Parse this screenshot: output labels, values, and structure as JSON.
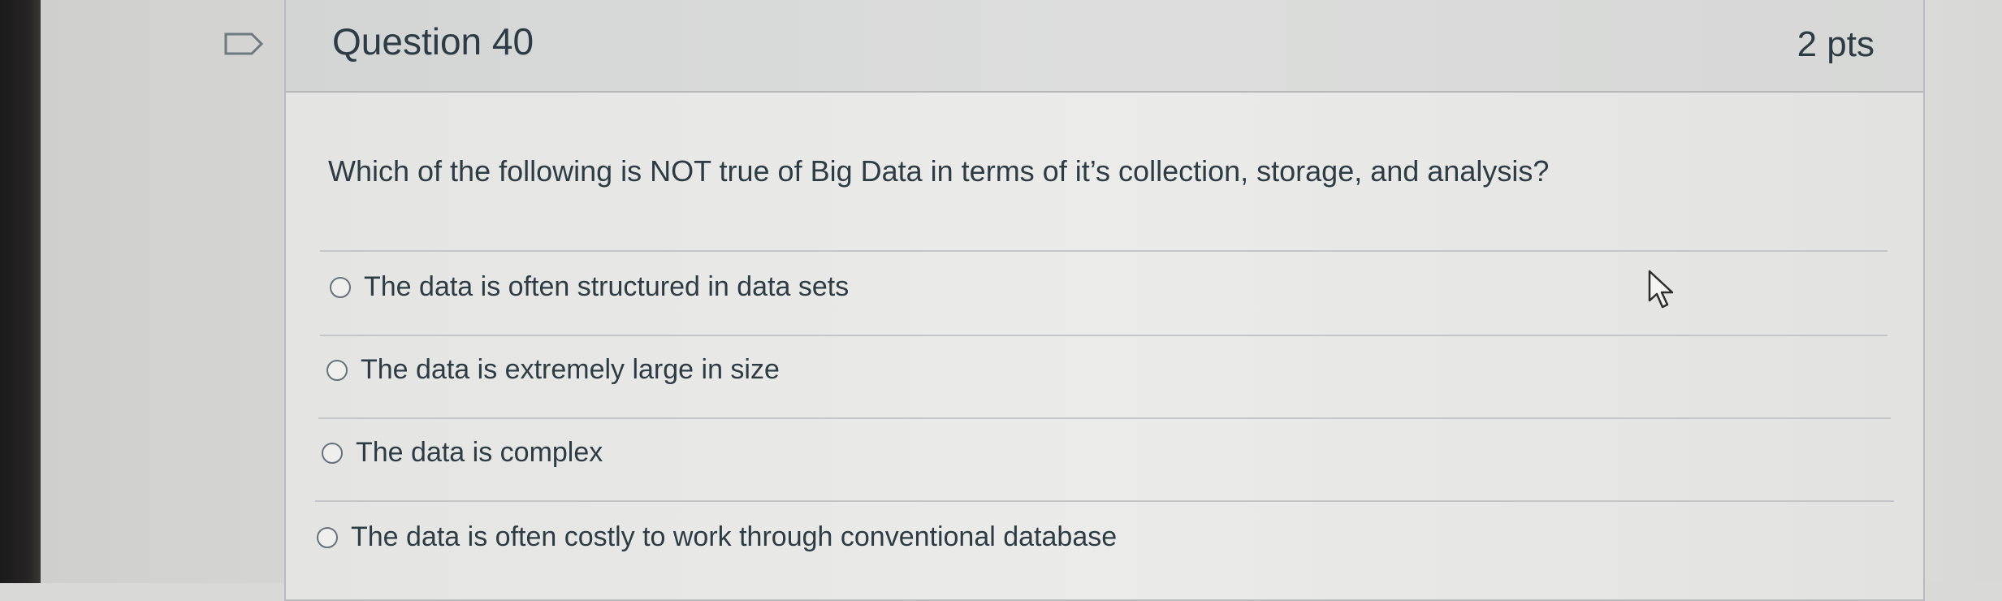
{
  "question": {
    "title": "Question 40",
    "points": "2 pts",
    "text": "Which of the following is NOT true of Big Data in terms of it’s collection, storage, and analysis?"
  },
  "answers": [
    {
      "label": "The data is often structured in data sets"
    },
    {
      "label": "The data is extremely large in size"
    },
    {
      "label": "The data is complex"
    },
    {
      "label": "The data is often costly to work through conventional database"
    }
  ],
  "icons": {
    "flag": "bookmark-flag-icon",
    "cursor": "mouse-pointer-icon",
    "radio": "radio-button-icon"
  },
  "colors": {
    "text": "#2d3b45",
    "header_bg": "#d6d7d6",
    "border": "#b8bcbf"
  }
}
